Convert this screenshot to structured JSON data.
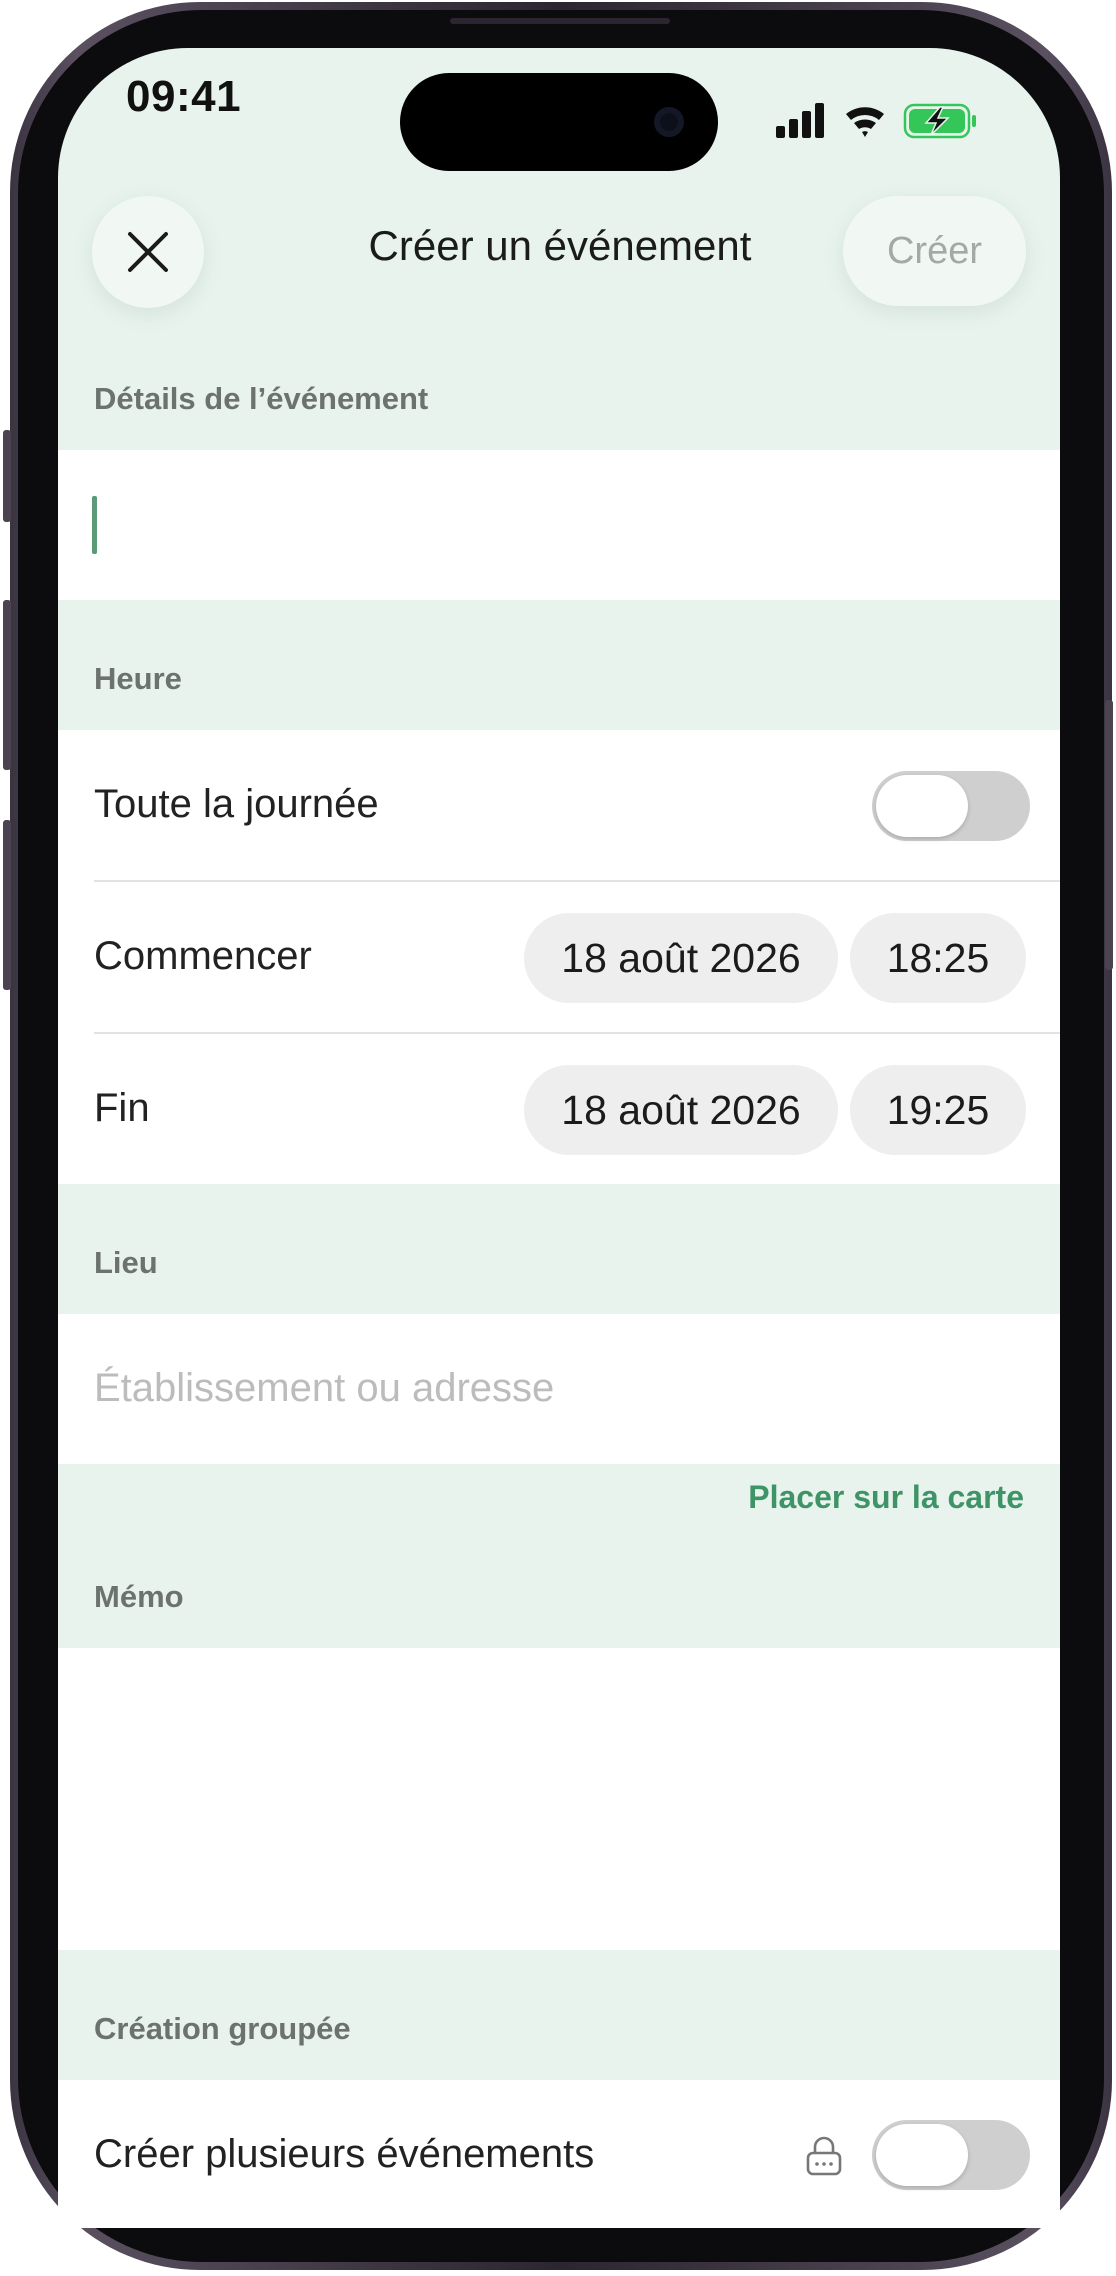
{
  "status_bar": {
    "time": "09:41"
  },
  "header": {
    "title": "Créer un événement",
    "create_label": "Créer"
  },
  "sections": {
    "details": {
      "label": "Détails de l’événement",
      "title_value": ""
    },
    "time": {
      "label": "Heure",
      "all_day_label": "Toute la journée",
      "all_day_on": false,
      "start_label": "Commencer",
      "start_date": "18 août 2026",
      "start_time": "18:25",
      "end_label": "Fin",
      "end_date": "18 août 2026",
      "end_time": "19:25"
    },
    "location": {
      "label": "Lieu",
      "placeholder": "Établissement ou adresse",
      "map_link": "Placer sur la carte"
    },
    "memo": {
      "label": "Mémo",
      "value": ""
    },
    "bulk": {
      "label": "Création groupée",
      "multi_label": "Créer plusieurs événements",
      "multi_on": false
    }
  },
  "colors": {
    "background": "#e8f3ed",
    "accent": "#3e9467",
    "toggle_off": "#cfcfcf",
    "battery_charging": "#35c659"
  },
  "icons": [
    "close-icon",
    "signal-icon",
    "wifi-icon",
    "battery-charging-icon",
    "lock-icon"
  ]
}
